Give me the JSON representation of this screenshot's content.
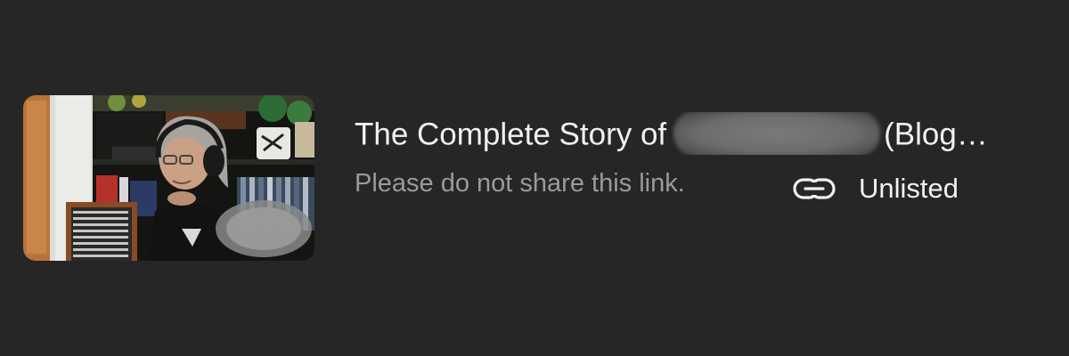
{
  "video": {
    "title_prefix": "The Complete Story of",
    "title_suffix": "(Blog…",
    "description": "Please do not share this link.",
    "visibility": "Unlisted",
    "visibility_icon": "link-icon"
  },
  "colors": {
    "background": "#262626",
    "title": "#f1f1f1",
    "description": "#9a9a9a"
  }
}
